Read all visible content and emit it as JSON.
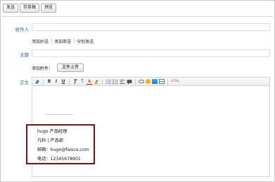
{
  "toolbar": {
    "send_label": "发送",
    "draft_label": "存草稿",
    "preview_label": "预览"
  },
  "compose": {
    "recipient_label": "收件人",
    "add_cc_label": "添加抄送",
    "add_bcc_label": "添加密送",
    "separate_send_label": "分别发送",
    "divider": "|",
    "subject_label": "主题",
    "attach_label": "添加附件：",
    "upload_label": "文件上传",
    "body_label": "正文"
  },
  "editor_toolbar": {
    "bold": "B",
    "italic": "I",
    "underline": "U",
    "font_size": "T",
    "font_color": "A",
    "html_source": "HTML"
  },
  "signature": {
    "line1": "hugo        产品经理",
    "line2": "凡科 | 产品部",
    "line3": "邮箱：hugo@faisco.com",
    "line4": "电话：12345678901"
  }
}
